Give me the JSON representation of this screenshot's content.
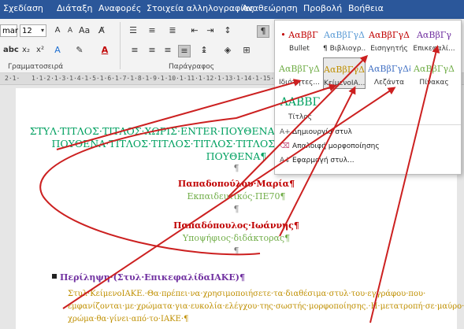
{
  "menubar": {
    "items": [
      "Σχεδίαση",
      "Διάταξη",
      "Αναφορές",
      "Στοιχεία αλληλογραφίας",
      "Αναθεώρηση",
      "Προβολή",
      "Βοήθεια"
    ],
    "bg": "#2b579a"
  },
  "ribbon": {
    "font_name": "mar",
    "font_size": "12",
    "group_font_label": "Γραμματοσειρά",
    "group_paragraph_label": "Παράγραφος"
  },
  "gallery": {
    "styles": [
      {
        "sample": "• ΑαΒβΓ",
        "name": "Bullet",
        "color": "#c00000"
      },
      {
        "sample": "ΑαΒβΓγΔ",
        "name": "¶ Βιβλιογρ...",
        "color": "#5b9bd5"
      },
      {
        "sample": "ΑαΒβΓγΔ",
        "name": "Εισηγητής",
        "color": "#c00000"
      },
      {
        "sample": "ΑαΒβΓγ",
        "name": "Επικεφαλί...",
        "color": "#7030a0"
      },
      {
        "sample": "ΑαΒβΓγΔ",
        "name": "Ιδιότητες...",
        "color": "#70ad47"
      },
      {
        "sample": "ΑαΒβΓγΔ",
        "name": "ΚείμενοΙΑ...",
        "color": "#bf8f00"
      },
      {
        "sample": "ΑαΒβΓγΔδΕ",
        "name": "Λεζάντα",
        "color": "#4472c4"
      },
      {
        "sample": "ΑαΒβΓγΔ",
        "name": "Πίνακας",
        "color": "#70ad47"
      },
      {
        "sample": "ΑΑΒΒΓ",
        "name": "Τίτλος",
        "color": "#00a060"
      }
    ],
    "commands": [
      "Δημιουργία στυλ",
      "Απαλοιφή μορφοποίησης",
      "Εφαρμογή στυλ..."
    ]
  },
  "document": {
    "title_lines": [
      "ΣΤΥΛ·ΤΙΤΛΟΣ·ΤΙΤΛΟΣ·ΧΩΡΙΣ·ENTER·ΠΟΥΘΕΝΑ·ΤΙΤΛΟΣ",
      "ΠΟΥΘΕΝΑ·ΤΙΤΛΟΣ·ΤΙΤΛΟΣ·ΤΙΤΛΟΣ·ΤΙΤΛΟΣ·ΧΩΡΙΣ",
      "ΠΟΥΘΕΝΑ¶"
    ],
    "pilcrow": "¶",
    "author1_name": "Παπαδοπούλου·Μαρία¶",
    "author1_role": "Εκπαιδευτικός·ΠΕ70¶",
    "author2_name": "Παπαδόπουλος·Ιωάννης¶",
    "author2_role": "Υποψήφιος·διδάκτορας¶",
    "abstract_heading": "Περίληψη·(Στυλ·ΕπικεφαλίδαΙΑΚΕ)¶",
    "body_lines": [
      "Στυλ·ΚείμενοΙΑΚΕ.·Θα·πρέπει·να·χρησιμοποιήσετε·τα·διαθέσιμα·στυλ·του·εγγράφου·που·",
      "εμφανίζονται·με·χρώματα·για·ευκολία·ελέγχου·της·σωστής·μορφοποίησης.·Η·μετατροπή·σε·μαύρο·",
      "χρώμα·θα·γίνει·από·το·ΙΑΚΕ·¶"
    ],
    "colors": {
      "title": "#00a060",
      "author_name": "#c00000",
      "author_role": "#70ad47",
      "heading": "#7030a0",
      "body": "#bf8f00",
      "arrow": "#cc2020"
    }
  }
}
